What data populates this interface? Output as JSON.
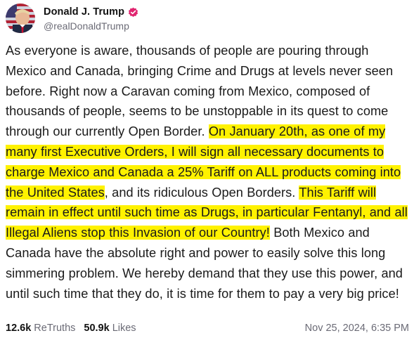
{
  "author": {
    "display_name": "Donald J. Trump",
    "handle": "@realDonaldTrump",
    "verified_icon": "verified-badge-icon",
    "verified_color": "#e0246f"
  },
  "post": {
    "segments": [
      {
        "text": "As everyone is aware, thousands of people are pouring through Mexico and Canada, bringing Crime and Drugs at levels never seen before. Right now a Caravan coming from Mexico, composed of thousands of people, seems to be unstoppable in its quest to come through our currently Open Border. ",
        "highlight": false
      },
      {
        "text": "On January 20th, as one of my many first Executive Orders, I will sign all necessary documents to charge Mexico and Canada a 25% Tariff on ALL products coming into the United States",
        "highlight": true
      },
      {
        "text": ", and its ridiculous Open Borders. ",
        "highlight": false
      },
      {
        "text": "This Tariff will remain in effect until such time as Drugs, in particular Fentanyl, and all Illegal Aliens stop this Invasion of our Country!",
        "highlight": true
      },
      {
        "text": " Both Mexico and Canada have the absolute right and power to easily solve this long simmering problem. We hereby demand that they use this power, and until such time that they do, it is time for them to pay a very big price!",
        "highlight": false
      }
    ],
    "highlight_color": "#fff200"
  },
  "stats": {
    "retruths_count": "12.6k",
    "retruths_label": "ReTruths",
    "likes_count": "50.9k",
    "likes_label": "Likes"
  },
  "timestamp": "Nov 25, 2024, 6:35 PM"
}
